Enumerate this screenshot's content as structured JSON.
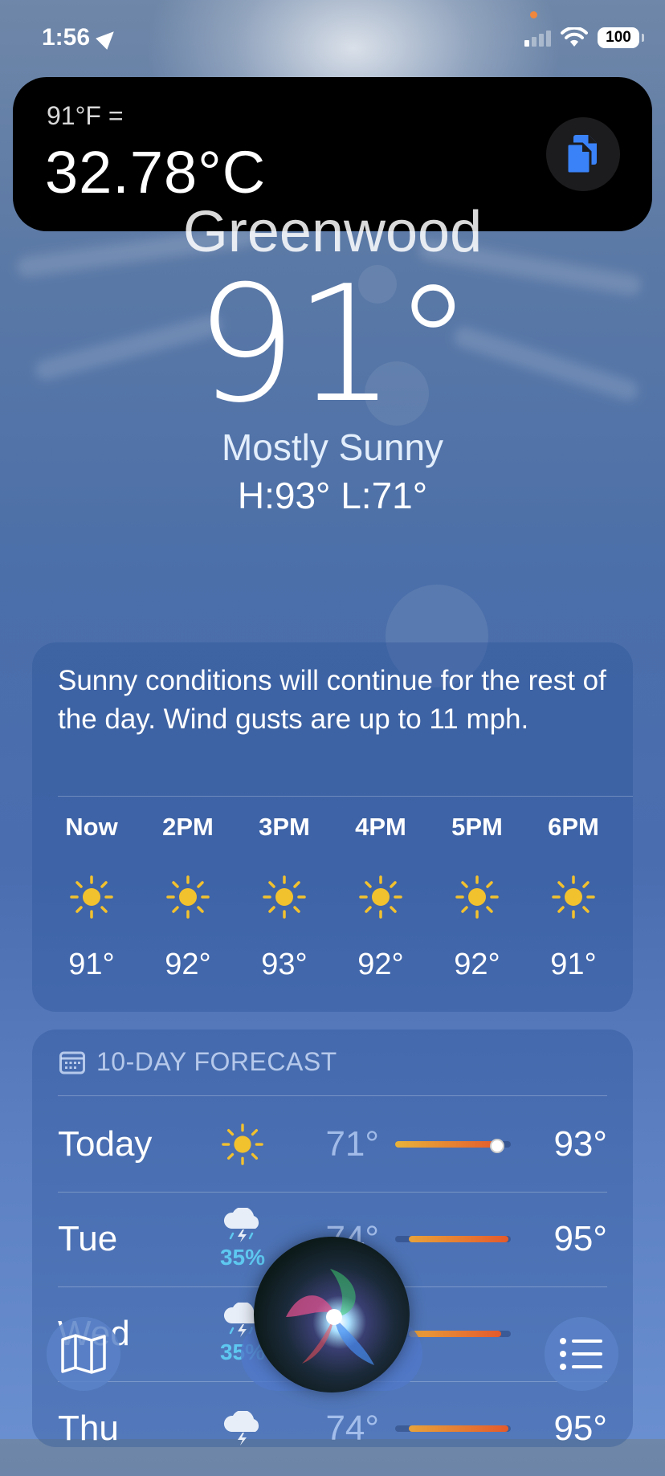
{
  "status_bar": {
    "time": "1:56",
    "battery": "100",
    "icons": [
      "location-arrow-icon",
      "cellular-signal-icon",
      "wifi-icon",
      "battery-icon"
    ]
  },
  "siri_result": {
    "expression": "91°F =",
    "result": "32.78°C",
    "copy_icon": "copy-icon"
  },
  "weather": {
    "city": "Greenwood",
    "temperature": "91°",
    "condition": "Mostly Sunny",
    "high_low": "H:93°  L:71°"
  },
  "hourly": {
    "summary": "Sunny conditions will continue for the rest of the day. Wind gusts are up to 11 mph.",
    "hours": [
      {
        "label": "Now",
        "temp": "91°",
        "icon": "sun-icon"
      },
      {
        "label": "2PM",
        "temp": "92°",
        "icon": "sun-icon"
      },
      {
        "label": "3PM",
        "temp": "93°",
        "icon": "sun-icon"
      },
      {
        "label": "4PM",
        "temp": "92°",
        "icon": "sun-icon"
      },
      {
        "label": "5PM",
        "temp": "92°",
        "icon": "sun-icon"
      },
      {
        "label": "6PM",
        "temp": "91°",
        "icon": "sun-icon"
      }
    ]
  },
  "daily": {
    "title": "10-DAY FORECAST",
    "days": [
      {
        "name": "Today",
        "low": "71°",
        "high": "93°",
        "icon": "sun-icon",
        "precip": ""
      },
      {
        "name": "Tue",
        "low": "74°",
        "high": "95°",
        "icon": "thunderstorm-icon",
        "precip": "35%"
      },
      {
        "name": "Wed",
        "low": "",
        "high": "",
        "icon": "thunderstorm-icon",
        "precip": "35%"
      },
      {
        "name": "Thu",
        "low": "74°",
        "high": "95°",
        "icon": "thunderstorm-icon",
        "precip": ""
      }
    ]
  },
  "controls": {
    "map_icon": "map-icon",
    "list_icon": "list-icon"
  },
  "colors": {
    "accent_sun": "#f2c12e",
    "precip_text": "#5ec8f0",
    "temp_bar_warm": "#e8a23a",
    "temp_bar_hot": "#e45a2c"
  }
}
